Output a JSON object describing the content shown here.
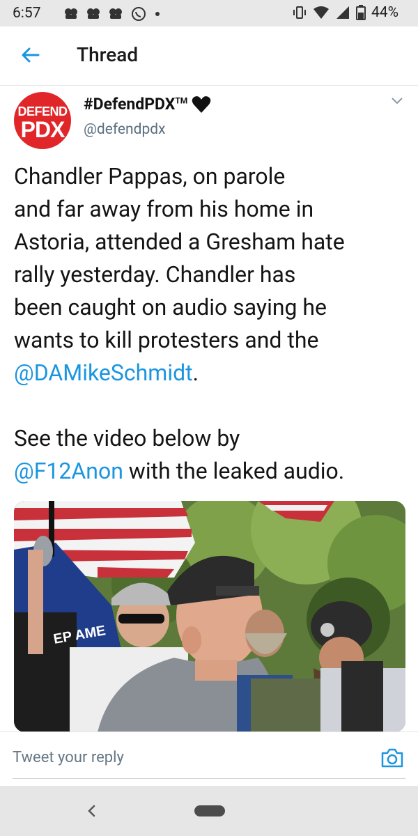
{
  "status_bar": {
    "time": "6:57",
    "battery": "44%"
  },
  "header": {
    "title": "Thread"
  },
  "tweet": {
    "avatar": {
      "line1": "DEFEND",
      "line2": "PDX"
    },
    "display_name": "#DefendPDX",
    "tm": "TM",
    "handle": "@defendpdx",
    "text": {
      "lines1": [
        "Chandler Pappas, on parole",
        "and far away from his home in",
        "Astoria, attended a Gresham hate",
        "rally yesterday. Chandler has",
        "been caught on audio saying he",
        "wants to kill protesters and the"
      ],
      "mention1": "@DAMikeSchmidt",
      "after_mention1": ".",
      "line_see": "See the video below by",
      "mention2": "@F12Anon",
      "after_mention2": " with the leaked audio."
    },
    "media": {
      "flag_text": "EP AME"
    }
  },
  "reply": {
    "placeholder": "Tweet your reply"
  },
  "colors": {
    "accent": "#1b95e0",
    "avatar_red": "#e1262a"
  }
}
